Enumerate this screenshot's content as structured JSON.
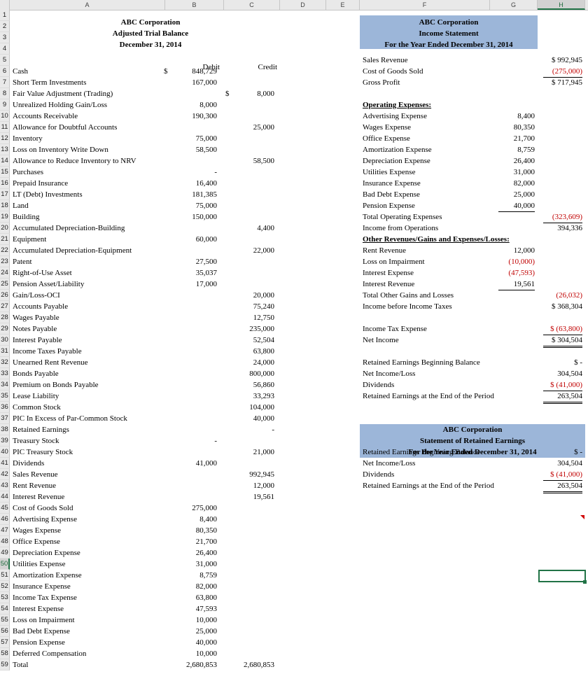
{
  "columns": [
    "A",
    "B",
    "C",
    "D",
    "E",
    "F",
    "G",
    "H"
  ],
  "rows": [
    "1",
    "2",
    "3",
    "4",
    "5",
    "6",
    "7",
    "8",
    "9",
    "10",
    "11",
    "12",
    "13",
    "14",
    "15",
    "16",
    "17",
    "18",
    "19",
    "20",
    "21",
    "22",
    "23",
    "24",
    "25",
    "26",
    "27",
    "28",
    "29",
    "30",
    "31",
    "32",
    "33",
    "34",
    "35",
    "36",
    "37",
    "38",
    "39",
    "40",
    "41",
    "42",
    "43",
    "44",
    "45",
    "46",
    "47",
    "48",
    "49",
    "50",
    "51",
    "52",
    "53",
    "54",
    "55",
    "56",
    "57",
    "58",
    "59"
  ],
  "selected_cell": "H50",
  "trial_balance": {
    "title": [
      "ABC Corporation",
      "Adjusted Trial Balance",
      "December 31, 2014"
    ],
    "debit_header": "Debit",
    "credit_header": "Credit",
    "lines": [
      {
        "name": "Cash",
        "ds": "$",
        "debit": "848,729",
        "cs": "",
        "credit": ""
      },
      {
        "name": "Short Term Investments",
        "ds": "",
        "debit": "167,000",
        "cs": "",
        "credit": ""
      },
      {
        "name": "Fair Value Adjustment (Trading)",
        "ds": "",
        "debit": "",
        "cs": "$",
        "credit": "8,000"
      },
      {
        "name": "Unrealized Holding Gain/Loss",
        "ds": "",
        "debit": "8,000",
        "cs": "",
        "credit": ""
      },
      {
        "name": "Accounts Receivable",
        "ds": "",
        "debit": "190,300",
        "cs": "",
        "credit": ""
      },
      {
        "name": "Allowance for Doubtful Accounts",
        "ds": "",
        "debit": "",
        "cs": "",
        "credit": "25,000"
      },
      {
        "name": "Inventory",
        "ds": "",
        "debit": "75,000",
        "cs": "",
        "credit": ""
      },
      {
        "name": "Loss on Inventory Write Down",
        "ds": "",
        "debit": "58,500",
        "cs": "",
        "credit": ""
      },
      {
        "name": "Allowance to Reduce Inventory to NRV",
        "ds": "",
        "debit": "",
        "cs": "",
        "credit": "58,500"
      },
      {
        "name": "Purchases",
        "ds": "",
        "debit": "-",
        "cs": "",
        "credit": ""
      },
      {
        "name": "Prepaid Insurance",
        "ds": "",
        "debit": "16,400",
        "cs": "",
        "credit": ""
      },
      {
        "name": "LT (Debt) Investments",
        "ds": "",
        "debit": "181,385",
        "cs": "",
        "credit": ""
      },
      {
        "name": "Land",
        "ds": "",
        "debit": "75,000",
        "cs": "",
        "credit": ""
      },
      {
        "name": "Building",
        "ds": "",
        "debit": "150,000",
        "cs": "",
        "credit": ""
      },
      {
        "name": "Accumulated Depreciation-Building",
        "ds": "",
        "debit": "",
        "cs": "",
        "credit": "4,400"
      },
      {
        "name": "Equipment",
        "ds": "",
        "debit": "60,000",
        "cs": "",
        "credit": ""
      },
      {
        "name": "Accumulated Depreciation-Equipment",
        "ds": "",
        "debit": "",
        "cs": "",
        "credit": "22,000"
      },
      {
        "name": "Patent",
        "ds": "",
        "debit": "27,500",
        "cs": "",
        "credit": ""
      },
      {
        "name": "Right-of-Use Asset",
        "ds": "",
        "debit": "35,037",
        "cs": "",
        "credit": ""
      },
      {
        "name": "Pension Asset/Liability",
        "ds": "",
        "debit": "17,000",
        "cs": "",
        "credit": ""
      },
      {
        "name": "Gain/Loss-OCI",
        "ds": "",
        "debit": "",
        "cs": "",
        "credit": "20,000"
      },
      {
        "name": "Accounts Payable",
        "ds": "",
        "debit": "",
        "cs": "",
        "credit": "75,240"
      },
      {
        "name": "Wages Payable",
        "ds": "",
        "debit": "",
        "cs": "",
        "credit": "12,750"
      },
      {
        "name": "Notes Payable",
        "ds": "",
        "debit": "",
        "cs": "",
        "credit": "235,000"
      },
      {
        "name": "Interest Payable",
        "ds": "",
        "debit": "",
        "cs": "",
        "credit": "52,504"
      },
      {
        "name": "Income Taxes Payable",
        "ds": "",
        "debit": "",
        "cs": "",
        "credit": "63,800"
      },
      {
        "name": "Unearned Rent Revenue",
        "ds": "",
        "debit": "",
        "cs": "",
        "credit": "24,000"
      },
      {
        "name": "Bonds Payable",
        "ds": "",
        "debit": "",
        "cs": "",
        "credit": "800,000"
      },
      {
        "name": "Premium on Bonds Payable",
        "ds": "",
        "debit": "",
        "cs": "",
        "credit": "56,860"
      },
      {
        "name": "Lease Liability",
        "ds": "",
        "debit": "",
        "cs": "",
        "credit": "33,293"
      },
      {
        "name": "Common Stock",
        "ds": "",
        "debit": "",
        "cs": "",
        "credit": "104,000"
      },
      {
        "name": "PIC In Excess of Par-Common Stock",
        "ds": "",
        "debit": "",
        "cs": "",
        "credit": "40,000"
      },
      {
        "name": "Retained Earnings",
        "ds": "",
        "debit": "",
        "cs": "",
        "credit": "-"
      },
      {
        "name": "Treasury Stock",
        "ds": "",
        "debit": "-",
        "cs": "",
        "credit": ""
      },
      {
        "name": "PIC Treasury Stock",
        "ds": "",
        "debit": "",
        "cs": "",
        "credit": "21,000"
      },
      {
        "name": "Dividends",
        "ds": "",
        "debit": "41,000",
        "cs": "",
        "credit": ""
      },
      {
        "name": "Sales Revenue",
        "ds": "",
        "debit": "",
        "cs": "",
        "credit": "992,945"
      },
      {
        "name": "Rent Revenue",
        "ds": "",
        "debit": "",
        "cs": "",
        "credit": "12,000"
      },
      {
        "name": "Interest Revenue",
        "ds": "",
        "debit": "",
        "cs": "",
        "credit": "19,561"
      },
      {
        "name": "Cost of Goods Sold",
        "ds": "",
        "debit": "275,000",
        "cs": "",
        "credit": ""
      },
      {
        "name": "Advertising Expense",
        "ds": "",
        "debit": "8,400",
        "cs": "",
        "credit": ""
      },
      {
        "name": "Wages Expense",
        "ds": "",
        "debit": "80,350",
        "cs": "",
        "credit": ""
      },
      {
        "name": "Office Expense",
        "ds": "",
        "debit": "21,700",
        "cs": "",
        "credit": ""
      },
      {
        "name": "Depreciation Expense",
        "ds": "",
        "debit": "26,400",
        "cs": "",
        "credit": ""
      },
      {
        "name": "Utilities Expense",
        "ds": "",
        "debit": "31,000",
        "cs": "",
        "credit": ""
      },
      {
        "name": "Amortization Expense",
        "ds": "",
        "debit": "8,759",
        "cs": "",
        "credit": ""
      },
      {
        "name": "Insurance Expense",
        "ds": "",
        "debit": "82,000",
        "cs": "",
        "credit": ""
      },
      {
        "name": "Income Tax Expense",
        "ds": "",
        "debit": "63,800",
        "cs": "",
        "credit": ""
      },
      {
        "name": "Interest Expense",
        "ds": "",
        "debit": "47,593",
        "cs": "",
        "credit": ""
      },
      {
        "name": "Loss on Impairment",
        "ds": "",
        "debit": "10,000",
        "cs": "",
        "credit": ""
      },
      {
        "name": "Bad Debt Expense",
        "ds": "",
        "debit": "25,000",
        "cs": "",
        "credit": ""
      },
      {
        "name": "Pension Expense",
        "ds": "",
        "debit": "40,000",
        "cs": "",
        "credit": ""
      },
      {
        "name": "Deferred Compensation",
        "ds": "",
        "debit": "10,000",
        "cs": "",
        "credit": ""
      },
      {
        "name": "Total",
        "ds": "",
        "debit": "2,680,853",
        "cs": "",
        "credit": "2,680,853"
      }
    ]
  },
  "income_statement": {
    "title": [
      "ABC Corporation",
      "Income Statement",
      "For the Year Ended December 31, 2014"
    ],
    "lines": [
      {
        "row": 5,
        "label": "Sales Revenue",
        "g": "",
        "h": "$ 992,945"
      },
      {
        "row": 6,
        "label": "Cost of Goods Sold",
        "g": "",
        "h": "(275,000)",
        "hc": "red ul"
      },
      {
        "row": 7,
        "label": "Gross Profit",
        "g": "",
        "h": "$ 717,945"
      },
      {
        "row": 9,
        "label": "Operating Expenses:",
        "g": "",
        "h": "",
        "lc": "b u"
      },
      {
        "row": 10,
        "label": "Advertising Expense",
        "g": "8,400",
        "h": ""
      },
      {
        "row": 11,
        "label": "Wages Expense",
        "g": "80,350",
        "h": ""
      },
      {
        "row": 12,
        "label": "Office Expense",
        "g": "21,700",
        "h": ""
      },
      {
        "row": 13,
        "label": "Amortization Expense",
        "g": "8,759",
        "h": ""
      },
      {
        "row": 14,
        "label": "Depreciation Expense",
        "g": "26,400",
        "h": ""
      },
      {
        "row": 15,
        "label": "Utilities Expense",
        "g": "31,000",
        "h": ""
      },
      {
        "row": 16,
        "label": "Insurance Expense",
        "g": "82,000",
        "h": ""
      },
      {
        "row": 17,
        "label": "Bad Debt Expense",
        "g": "25,000",
        "h": ""
      },
      {
        "row": 18,
        "label": "Pension Expense",
        "g": "40,000",
        "h": "",
        "gc": "ul"
      },
      {
        "row": 19,
        "label": "Total Operating Expenses",
        "g": "",
        "h": "(323,609)",
        "hc": "red ul"
      },
      {
        "row": 20,
        "label": "Income from Operations",
        "g": "",
        "h": "394,336"
      },
      {
        "row": 21,
        "label": "Other Revenues/Gains and Expenses/Losses:",
        "g": "",
        "h": "",
        "lc": "b u"
      },
      {
        "row": 22,
        "label": "Rent Revenue",
        "g": "12,000",
        "h": ""
      },
      {
        "row": 23,
        "label": "Loss on Impairment",
        "g": "(10,000)",
        "h": "",
        "gc": "red"
      },
      {
        "row": 24,
        "label": "Interest Expense",
        "g": "(47,593)",
        "h": "",
        "gc": "red"
      },
      {
        "row": 25,
        "label": "Interest Revenue",
        "g": "19,561",
        "h": "",
        "gc": "ul"
      },
      {
        "row": 26,
        "label": "Total Other Gains and Losses",
        "g": "",
        "h": "(26,032)",
        "hc": "red"
      },
      {
        "row": 27,
        "label": "Income before Income Taxes",
        "g": "",
        "h": "$ 368,304"
      },
      {
        "row": 29,
        "label": "Income Tax Expense",
        "g": "",
        "h": "$ (63,800)",
        "hc": "red ul"
      },
      {
        "row": 30,
        "label": "Net Income",
        "g": "",
        "h": "$ 304,504",
        "hc": "dul"
      },
      {
        "row": 32,
        "label": "Retained Earnings Beginning Balance",
        "g": "",
        "h": "$          -"
      },
      {
        "row": 33,
        "label": "Net Income/Loss",
        "g": "",
        "h": "304,504"
      },
      {
        "row": 34,
        "label": "Dividends",
        "g": "",
        "h": "$ (41,000)",
        "hc": "red ul"
      },
      {
        "row": 35,
        "label": "Retained Earnings at the End of the Period",
        "g": "",
        "h": "263,504",
        "hc": "dul"
      }
    ]
  },
  "retained_earnings_statement": {
    "title": [
      "ABC Corporation",
      "Statement of Retained Earnings",
      "For the Year Ended December 31, 2014"
    ],
    "lines": [
      {
        "row": 40,
        "label": "Retained Earnings Beginning Balance",
        "h": "$          -"
      },
      {
        "row": 41,
        "label": "Net Income/Loss",
        "h": "304,504"
      },
      {
        "row": 42,
        "label": "Dividends",
        "h": "$ (41,000)",
        "hc": "red ul"
      },
      {
        "row": 43,
        "label": "Retained Earnings at the End of the Period",
        "h": "263,504",
        "hc": "dul"
      }
    ]
  }
}
